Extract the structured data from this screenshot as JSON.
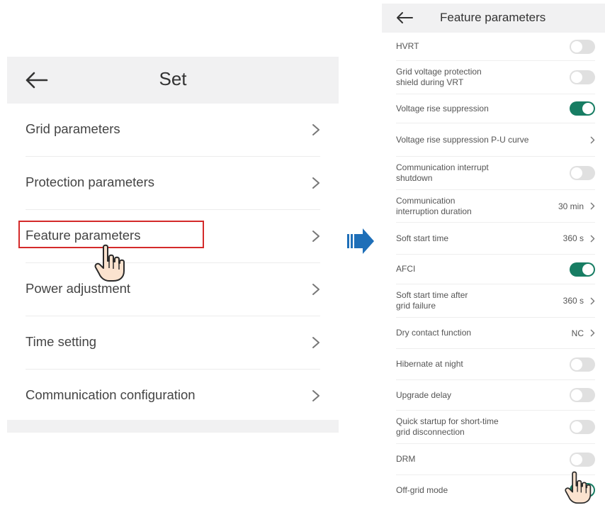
{
  "left_panel": {
    "title": "Set",
    "menu_items": [
      {
        "label": "Grid parameters"
      },
      {
        "label": "Protection parameters"
      },
      {
        "label": "Feature parameters"
      },
      {
        "label": "Power adjustment"
      },
      {
        "label": "Time setting"
      },
      {
        "label": "Communication configuration"
      }
    ],
    "highlighted_item": "Feature parameters",
    "highlight_color": "#d42a2a"
  },
  "arrow_color": "#1e6fb8",
  "right_panel": {
    "title": "Feature parameters",
    "accent_color": "#177d63",
    "rows": [
      {
        "label": [
          "HVRT"
        ],
        "control": "toggle",
        "on": false
      },
      {
        "label": [
          "Grid voltage protection",
          "shield during VRT"
        ],
        "control": "toggle",
        "on": false
      },
      {
        "label": [
          "Voltage rise suppression"
        ],
        "control": "toggle",
        "on": true
      },
      {
        "label": [
          "Voltage rise suppression P-U curve"
        ],
        "control": "link"
      },
      {
        "label": [
          "Communication interrupt",
          "shutdown"
        ],
        "control": "toggle",
        "on": false
      },
      {
        "label": [
          "Communication",
          "interruption duration"
        ],
        "control": "value",
        "value": "30 min"
      },
      {
        "label": [
          "Soft start time"
        ],
        "control": "value",
        "value": "360 s"
      },
      {
        "label": [
          "AFCI"
        ],
        "control": "toggle",
        "on": true
      },
      {
        "label": [
          "Soft start time after",
          "grid failure"
        ],
        "control": "value",
        "value": "360 s"
      },
      {
        "label": [
          "Dry contact function"
        ],
        "control": "value",
        "value": "NC"
      },
      {
        "label": [
          "Hibernate at night"
        ],
        "control": "toggle",
        "on": false
      },
      {
        "label": [
          "Upgrade delay"
        ],
        "control": "toggle",
        "on": false
      },
      {
        "label": [
          "Quick startup for short-time",
          "grid disconnection"
        ],
        "control": "toggle",
        "on": false
      },
      {
        "label": [
          "DRM"
        ],
        "control": "toggle",
        "on": false
      },
      {
        "label": [
          "Off-grid mode"
        ],
        "control": "toggle",
        "on": true
      }
    ]
  },
  "icons": [
    "back-arrow-icon",
    "chevron-right-icon",
    "pointing-hand-icon",
    "right-arrow-icon"
  ]
}
